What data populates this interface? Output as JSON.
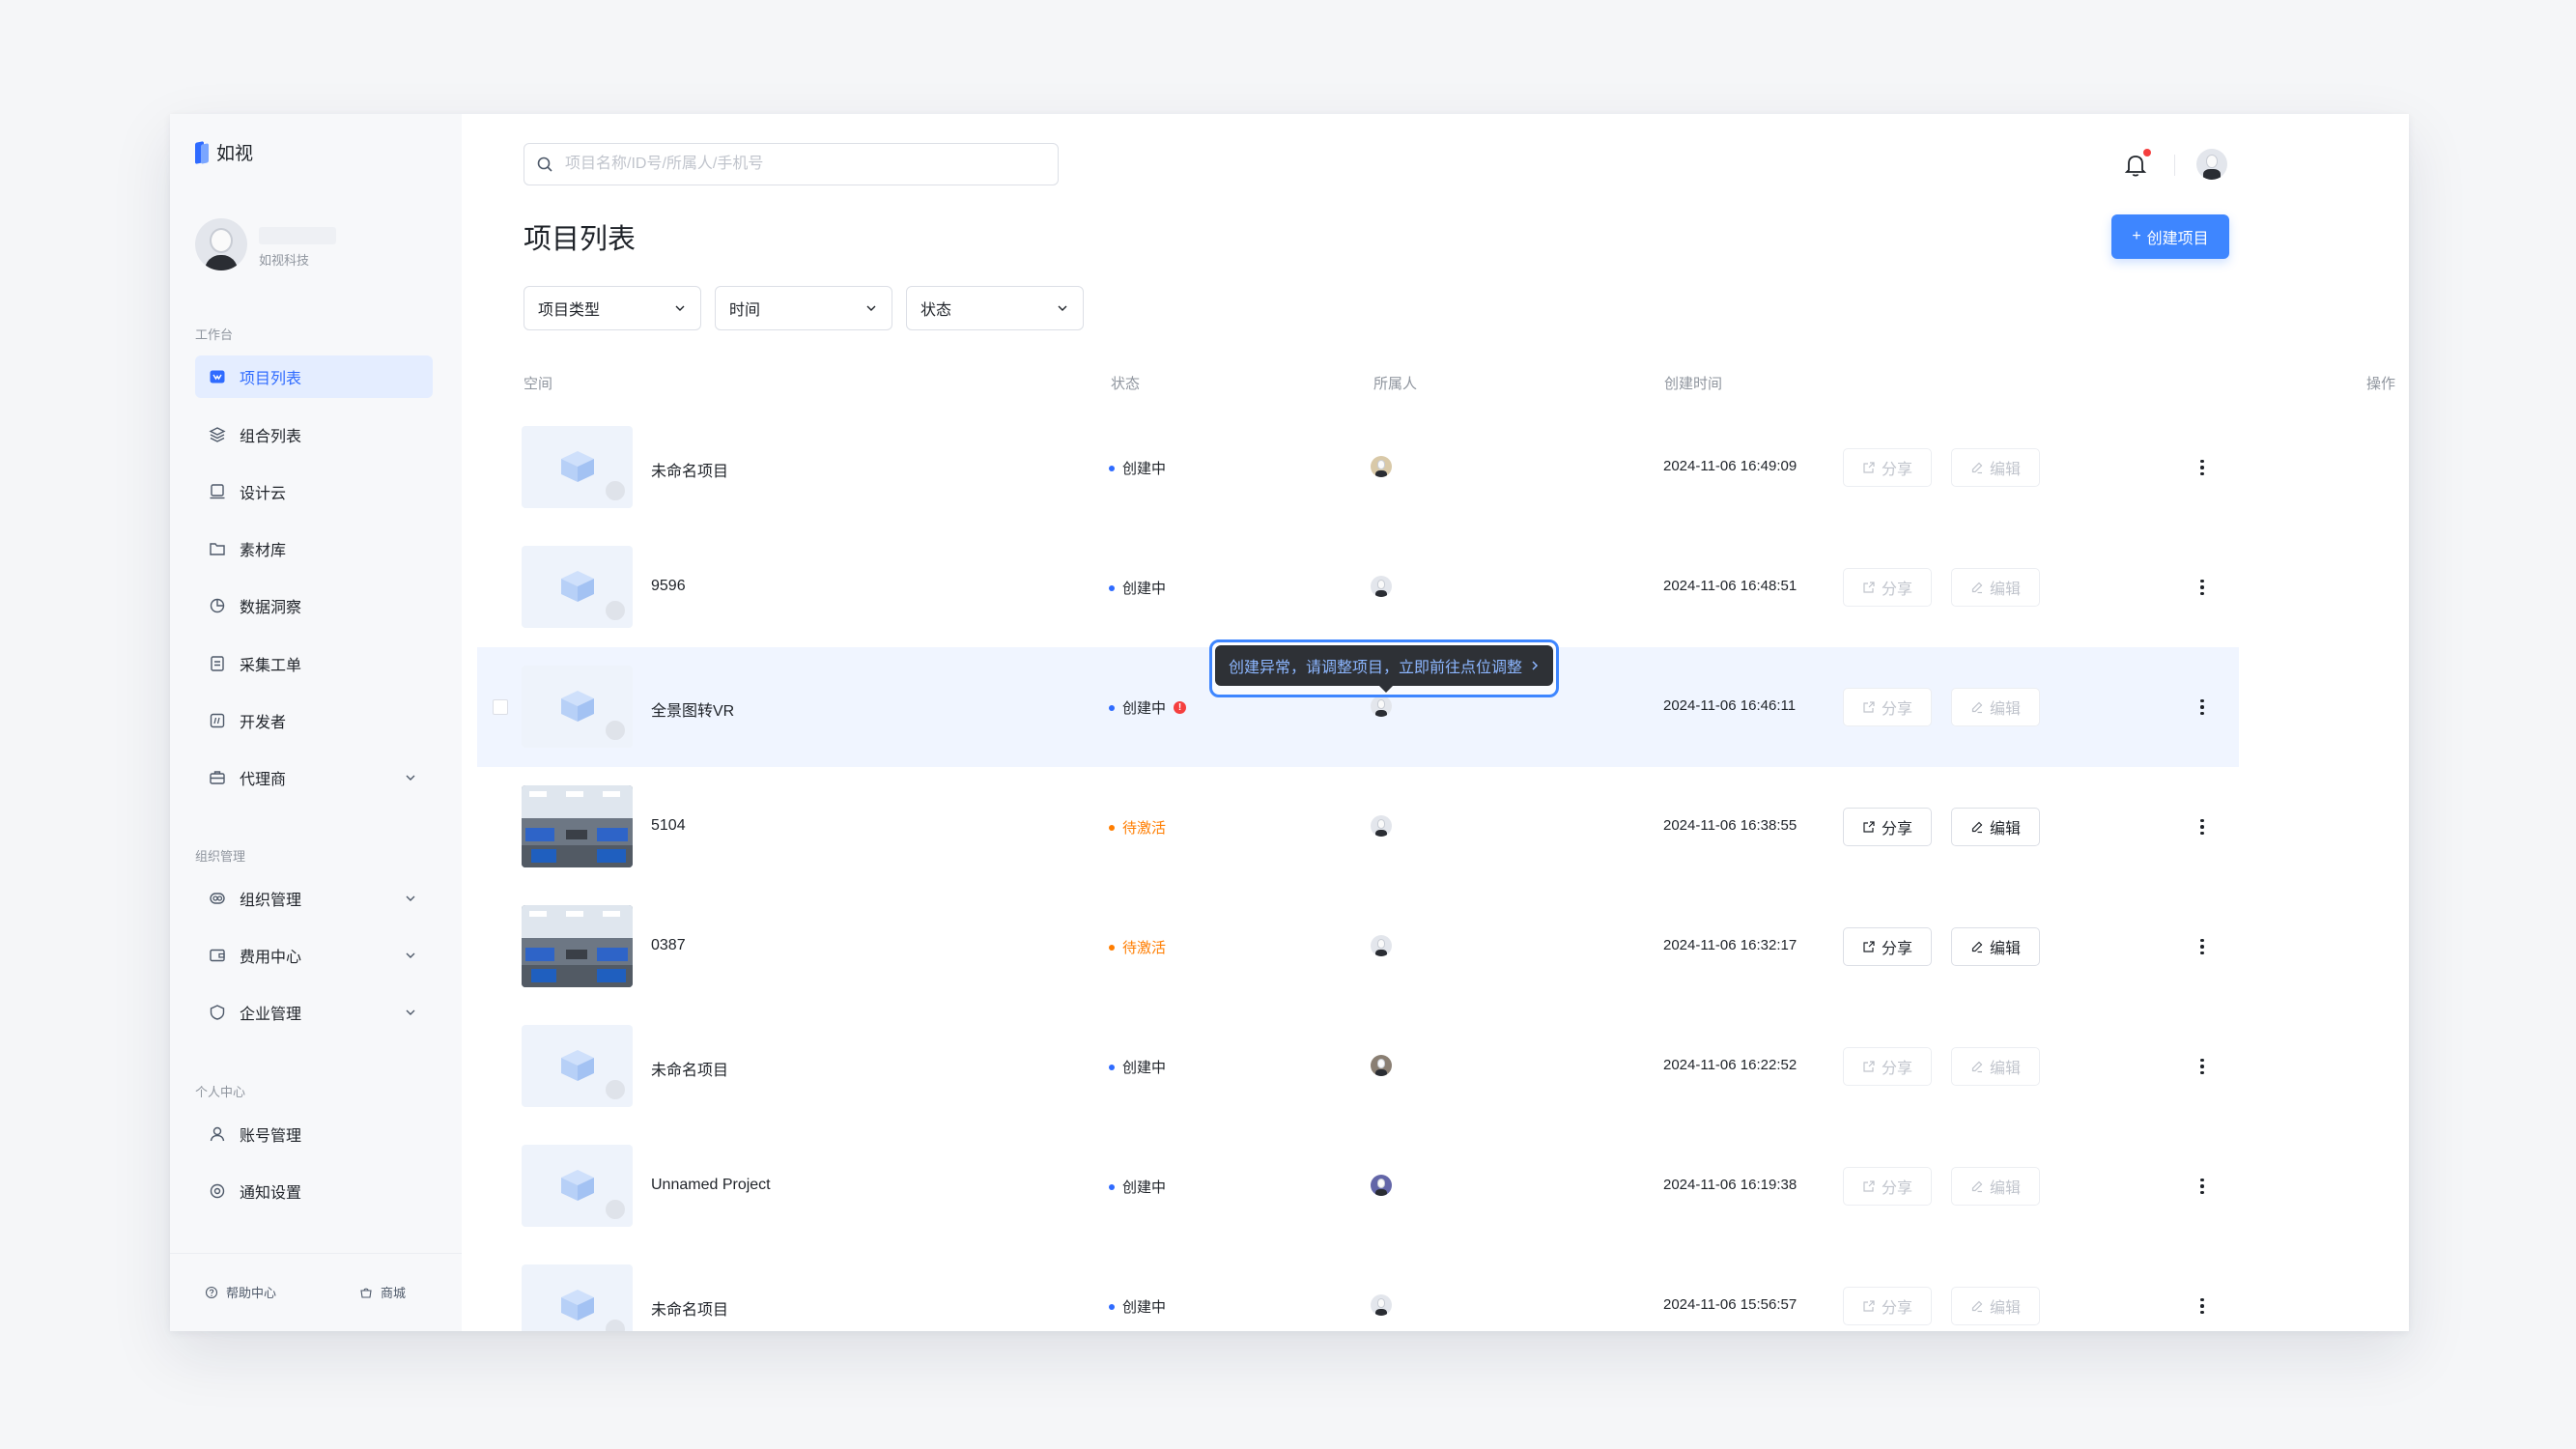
{
  "app": {
    "name": "如视"
  },
  "org": {
    "name": "如视科技"
  },
  "search": {
    "placeholder": "项目名称/ID号/所属人/手机号"
  },
  "sidebar": {
    "sections": {
      "workbench": "工作台",
      "org_manage": "组织管理",
      "personal": "个人中心"
    },
    "items": [
      {
        "label": "项目列表",
        "icon": "project-list-icon",
        "active": true
      },
      {
        "label": "组合列表",
        "icon": "layers-icon"
      },
      {
        "label": "设计云",
        "icon": "design-cloud-icon"
      },
      {
        "label": "素材库",
        "icon": "folder-icon"
      },
      {
        "label": "数据洞察",
        "icon": "pie-chart-icon"
      },
      {
        "label": "采集工单",
        "icon": "work-order-icon"
      },
      {
        "label": "开发者",
        "icon": "developer-icon"
      },
      {
        "label": "代理商",
        "icon": "briefcase-icon",
        "expandable": true
      },
      {
        "label": "组织管理",
        "icon": "organization-icon",
        "expandable": true
      },
      {
        "label": "费用中心",
        "icon": "wallet-icon",
        "expandable": true
      },
      {
        "label": "企业管理",
        "icon": "enterprise-icon",
        "expandable": true
      },
      {
        "label": "账号管理",
        "icon": "user-icon"
      },
      {
        "label": "通知设置",
        "icon": "notification-settings-icon"
      }
    ],
    "footer": {
      "help": "帮助中心",
      "store": "商城"
    }
  },
  "page": {
    "title": "项目列表",
    "create_button": "创建项目"
  },
  "filters": [
    {
      "label": "项目类型"
    },
    {
      "label": "时间"
    },
    {
      "label": "状态"
    }
  ],
  "table": {
    "columns": {
      "space": "空间",
      "status": "状态",
      "owner": "所属人",
      "created": "创建时间",
      "actions": "操作"
    },
    "actions": {
      "share": "分享",
      "edit": "编辑"
    },
    "rows": [
      {
        "name": "未命名项目",
        "status": "创建中",
        "status_color": "#2f6bff",
        "created": "2024-11-06 16:49:09",
        "thumb": "placeholder",
        "actions_enabled": false
      },
      {
        "name": "9596",
        "status": "创建中",
        "status_color": "#2f6bff",
        "created": "2024-11-06 16:48:51",
        "thumb": "placeholder",
        "actions_enabled": false
      },
      {
        "name": "全景图转VR",
        "status": "创建中",
        "status_color": "#2f6bff",
        "created": "2024-11-06 16:46:11",
        "thumb": "placeholder",
        "actions_enabled": false,
        "error": true
      },
      {
        "name": "5104",
        "status": "待激活",
        "status_color": "#ff7d00",
        "created": "2024-11-06 16:38:55",
        "thumb": "photo",
        "actions_enabled": true
      },
      {
        "name": "0387",
        "status": "待激活",
        "status_color": "#ff7d00",
        "created": "2024-11-06 16:32:17",
        "thumb": "photo",
        "actions_enabled": true
      },
      {
        "name": "未命名项目",
        "status": "创建中",
        "status_color": "#2f6bff",
        "created": "2024-11-06 16:22:52",
        "thumb": "placeholder",
        "actions_enabled": false
      },
      {
        "name": "Unnamed Project",
        "status": "创建中",
        "status_color": "#2f6bff",
        "created": "2024-11-06 16:19:38",
        "thumb": "placeholder",
        "actions_enabled": false
      },
      {
        "name": "未命名项目",
        "status": "创建中",
        "status_color": "#2f6bff",
        "created": "2024-11-06 15:56:57",
        "thumb": "placeholder",
        "actions_enabled": false
      }
    ]
  },
  "tooltip": {
    "text": "创建异常，请调整项目，立即前往点位调整"
  },
  "colors": {
    "accent": "#3e86ff",
    "creating": "#2f6bff",
    "pending": "#ff7d00",
    "error": "#f53f3f"
  }
}
